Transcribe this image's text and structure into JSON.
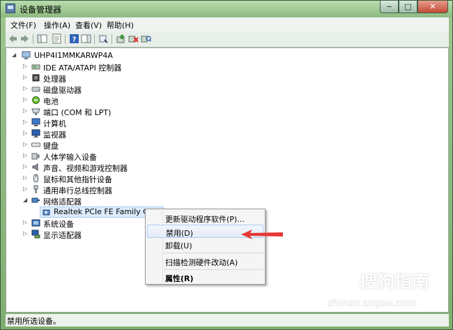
{
  "window": {
    "title": "设备管理器",
    "caption_buttons": [
      "−",
      "□",
      "✕"
    ]
  },
  "menu": [
    {
      "label": "文件(F)"
    },
    {
      "label": "操作(A)"
    },
    {
      "label": "查看(V)"
    },
    {
      "label": "帮助(H)"
    }
  ],
  "toolbar": {
    "icons": [
      "back-icon",
      "forward-icon",
      "console-tree-icon",
      "properties-icon",
      "help-icon",
      "action-pane-icon",
      "device-view-icon",
      "update-driver-icon",
      "uninstall-icon",
      "scan-hardware-icon"
    ]
  },
  "tree": {
    "root": "UHP4I1MMKARWP4A",
    "categories": [
      {
        "label": "IDE ATA/ATAPI 控制器"
      },
      {
        "label": "处理器"
      },
      {
        "label": "磁盘驱动器"
      },
      {
        "label": "电池"
      },
      {
        "label": "端口 (COM 和 LPT)"
      },
      {
        "label": "计算机"
      },
      {
        "label": "监视器"
      },
      {
        "label": "键盘"
      },
      {
        "label": "人体学输入设备"
      },
      {
        "label": "声音、视频和游戏控制器"
      },
      {
        "label": "鼠标和其他指针设备"
      },
      {
        "label": "通用串行总线控制器"
      },
      {
        "label": "网络适配器"
      },
      {
        "label": "Realtek PCIe FE Family Contro"
      },
      {
        "label": "系统设备"
      },
      {
        "label": "显示适配器"
      }
    ]
  },
  "context_menu": {
    "items": [
      {
        "label": "更新驱动程序软件(P)..."
      },
      {
        "label": "禁用(D)"
      },
      {
        "label": "卸载(U)"
      },
      {
        "label": "扫描检测硬件改动(A)"
      },
      {
        "label": "属性(R)"
      }
    ]
  },
  "status": {
    "text": "禁用所选设备。"
  },
  "watermark": {
    "text": "搜狗指南",
    "sub": "zhinan.sogou.com"
  },
  "colors": {
    "arrow": "#e53935",
    "selection": "#dcebfc"
  }
}
